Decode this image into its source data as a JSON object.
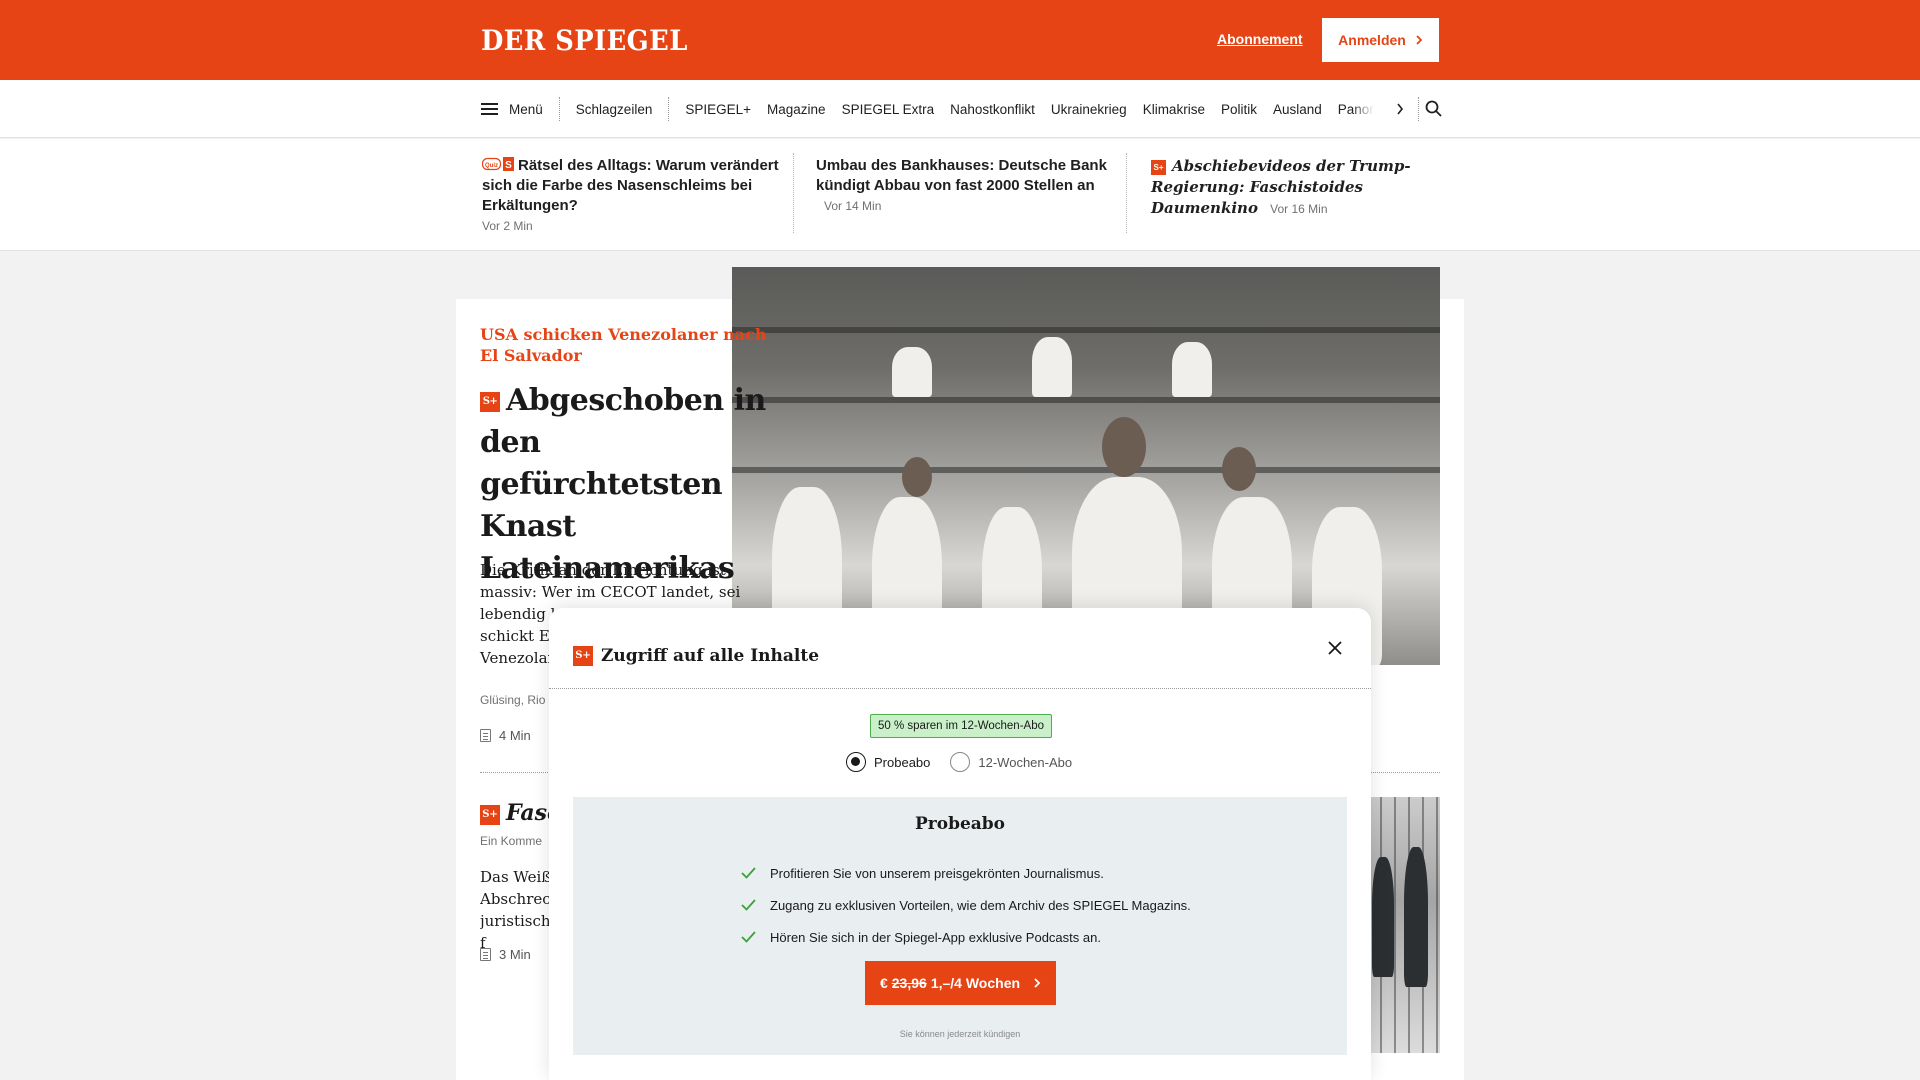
{
  "header": {
    "logo": "DER SPIEGEL",
    "abo_link": "Abonnement",
    "login_label": "Anmelden"
  },
  "nav": {
    "menu_label": "Menü",
    "headlines_label": "Schlagzeilen",
    "items": [
      "SPIEGEL+",
      "Magazine",
      "SPIEGEL Extra",
      "Nahostkonflikt",
      "Ukrainekrieg",
      "Klimakrise",
      "Politik",
      "Ausland"
    ],
    "overflow_item": "Panorama"
  },
  "teasers": [
    {
      "title": "Rätsel des Alltags: Warum verändert sich die Farbe des Nasenschleims bei Erkältungen?",
      "time": "Vor 2 Min",
      "icon": "quiz-icon"
    },
    {
      "title": "Umbau des Bankhauses: Deutsche Bank kündigt Abbau von fast 2000 Stellen an",
      "time": "Vor 14 Min"
    },
    {
      "title": "Abschiebevideos der Trump-Regierung: Faschistoides Daumenkino",
      "time": "Vor 16 Min",
      "badge": "S+"
    }
  ],
  "article": {
    "kicker": "USA schicken Venezolaner nach El Salvador",
    "badge": "S+",
    "headline": "Abgeschoben in den gefürchtetsten Knast Lateinamerikas",
    "lead": "Die Kritik an der Einrichtung ist massiv: Wer im CECOT landet, sei lebendig begraben, heißt es. Jetzt schickt El Salvador als 200 Venezolaner, Donald Trump",
    "authors": "Glüsing, Rio",
    "readtime": "4 Min"
  },
  "article2": {
    "badge": "S+",
    "title": "Fasc",
    "subtitle": "Ein Komme",
    "lead": "Das Weiß Abschreck juristisch f",
    "readtime": "3 Min"
  },
  "modal": {
    "badge": "S+",
    "title": "Zugriff auf alle Inhalte",
    "save_badge": "50 % sparen im 12-Wochen-Abo",
    "options": [
      "Probeabo",
      "12-Wochen-Abo"
    ],
    "selected_option": "Probeabo",
    "plan_title": "Probeabo",
    "benefits": [
      "Profitieren Sie von unserem preisgekrönten Journalismus.",
      "Zugang zu exklusiven Vorteilen, wie dem Archiv des SPIEGEL Magazins.",
      "Hören Sie sich in der Spiegel-App exklusive Podcasts an."
    ],
    "cta_currency": "€",
    "cta_old_price": "23,96",
    "cta_new_price": "1,–/4 Wochen",
    "fineprint": "Sie können jederzeit kündigen"
  },
  "colors": {
    "brand": "#e64415",
    "save_badge_bg": "#c9f0c9",
    "check": "#3aa03a",
    "plan_bg": "#e9eef0"
  }
}
